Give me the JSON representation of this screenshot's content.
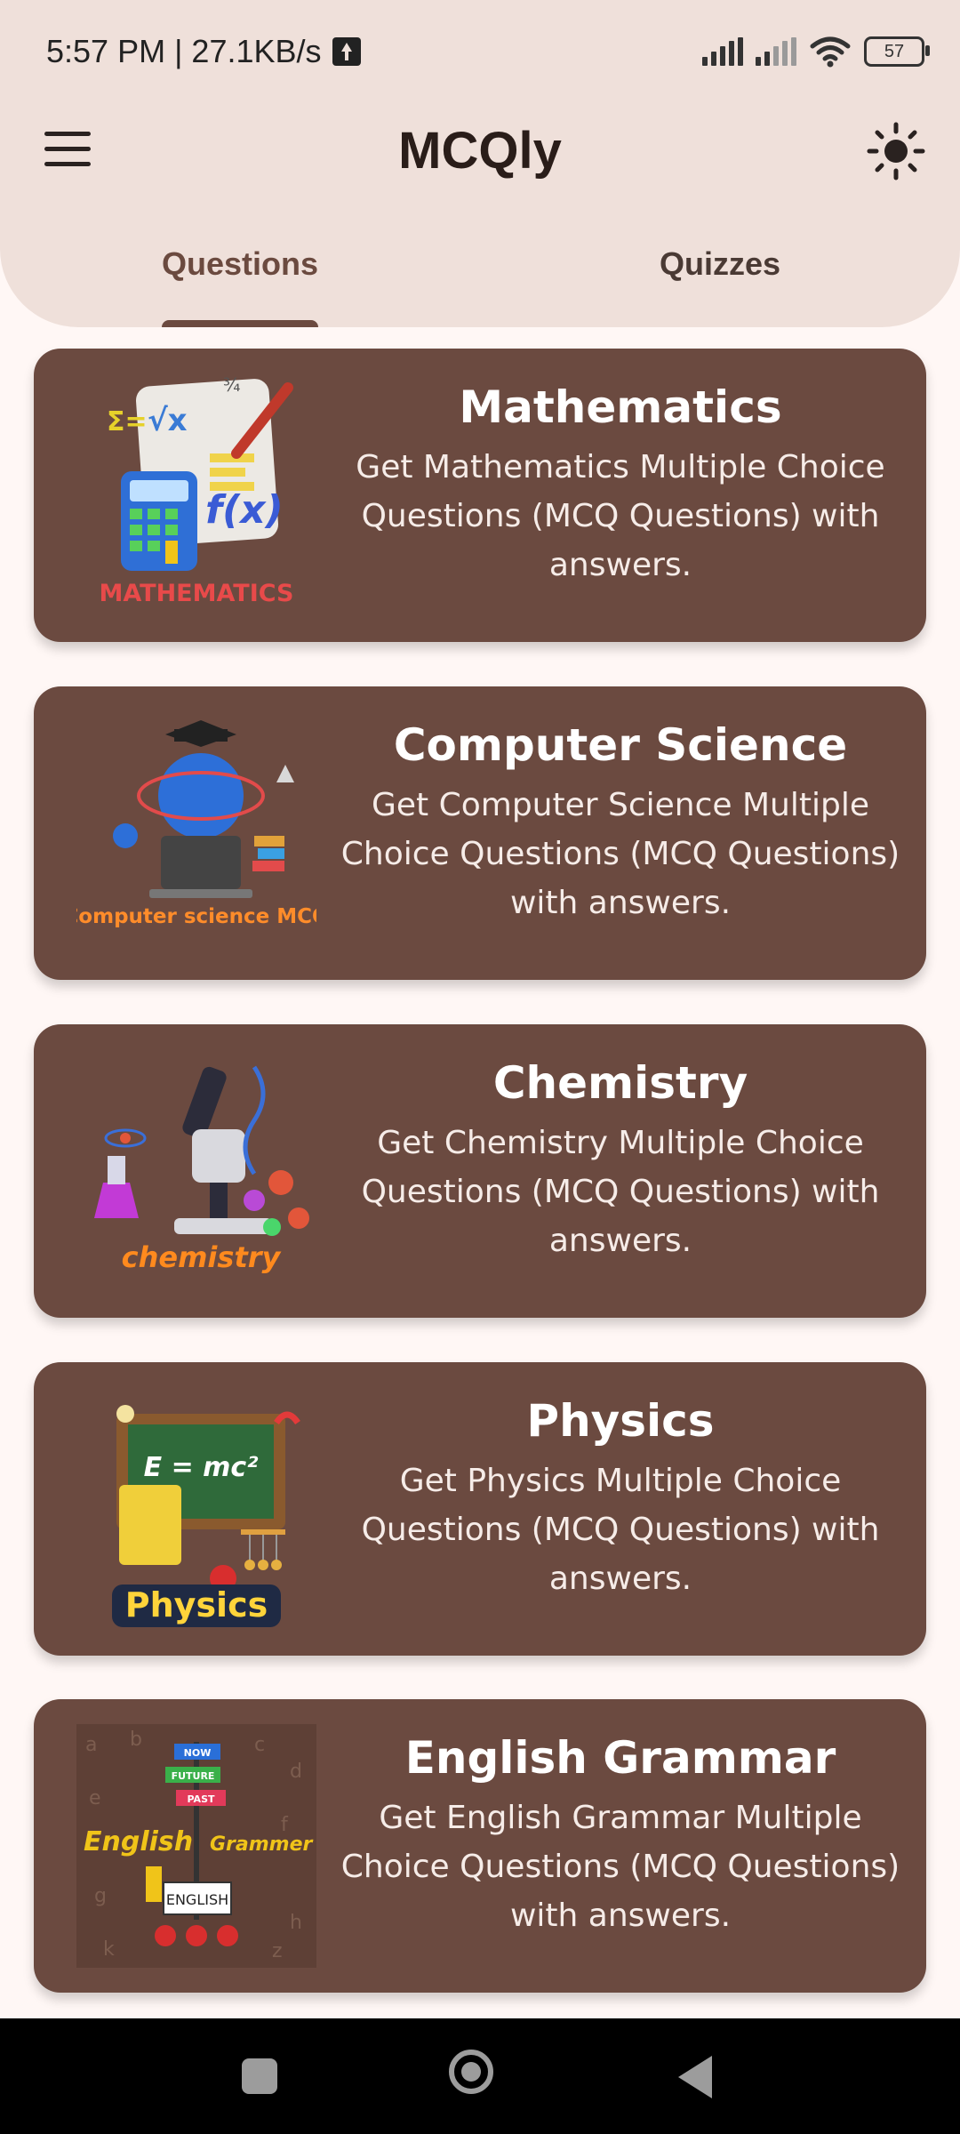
{
  "status_bar": {
    "time_speed": "5:57 PM | 27.1KB/s",
    "battery": "57"
  },
  "app_bar": {
    "title": "MCQly",
    "menu_icon": "hamburger-menu-icon",
    "theme_icon": "sun-icon"
  },
  "tabs": [
    {
      "label": "Questions",
      "active": true
    },
    {
      "label": "Quizzes",
      "active": false
    }
  ],
  "subjects": [
    {
      "title": "Mathematics",
      "description": "Get Mathematics Multiple Choice Questions (MCQ Questions) with answers.",
      "image_label": "MATHEMATICS"
    },
    {
      "title": "Computer Science",
      "description": "Get Computer Science Multiple Choice Questions (MCQ Questions) with answers.",
      "image_label": "Computer science MCQ"
    },
    {
      "title": "Chemistry",
      "description": "Get Chemistry Multiple Choice Questions (MCQ Questions) with answers.",
      "image_label": "chemistry"
    },
    {
      "title": "Physics",
      "description": "Get Physics Multiple Choice Questions (MCQ Questions) with answers.",
      "image_label": "Physics",
      "image_formula": "E = mc²"
    },
    {
      "title": "English Grammar",
      "description": "Get English Grammar Multiple Choice Questions (MCQ Questions) with answers.",
      "image_label": "English",
      "image_label_2": "Grammer",
      "image_signs": [
        "NOW",
        "FUTURE",
        "PAST",
        "ENGLISH"
      ]
    }
  ],
  "colors": {
    "header_bg": "#efe0da",
    "card_bg": "#6b4a40",
    "page_bg": "#fff7f5",
    "accent": "#6b4a3f"
  }
}
